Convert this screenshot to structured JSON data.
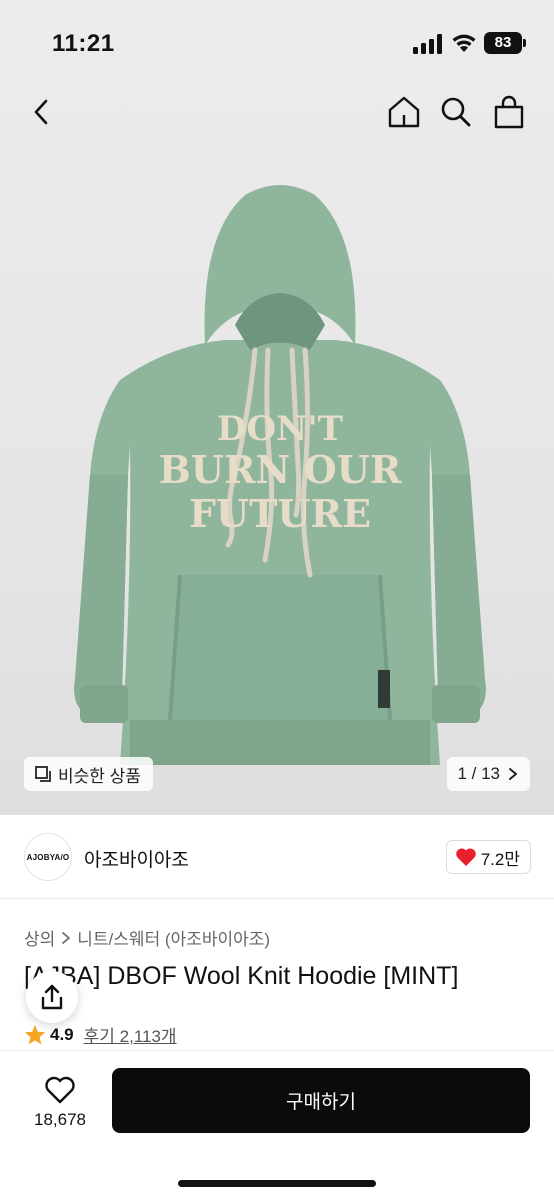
{
  "status": {
    "time": "11:21",
    "battery": "83"
  },
  "nav": {
    "icons": [
      "back-icon",
      "home-icon",
      "search-icon",
      "shopping-bag-icon"
    ]
  },
  "gallery": {
    "image_text": "DON'T BURN OUR FUTURE",
    "tag_text": "AJOBYAJO",
    "similar_label": "비슷한 상품",
    "page_indicator": "1 / 13"
  },
  "store": {
    "logo_text": "AJOBYA/O",
    "name": "아조바이아조",
    "like_count": "7.2만",
    "accent_color": "#e8202e"
  },
  "breadcrumb": {
    "items": [
      "상의",
      "니트/스웨터 (아조바이아조)"
    ]
  },
  "product": {
    "title": "[AJBA] DBOF Wool Knit Hoodie [MINT]",
    "rating": "4.9",
    "reviews_label": "후기 2,113개"
  },
  "bottom": {
    "wish_count": "18,678",
    "buy_label": "구매하기"
  }
}
